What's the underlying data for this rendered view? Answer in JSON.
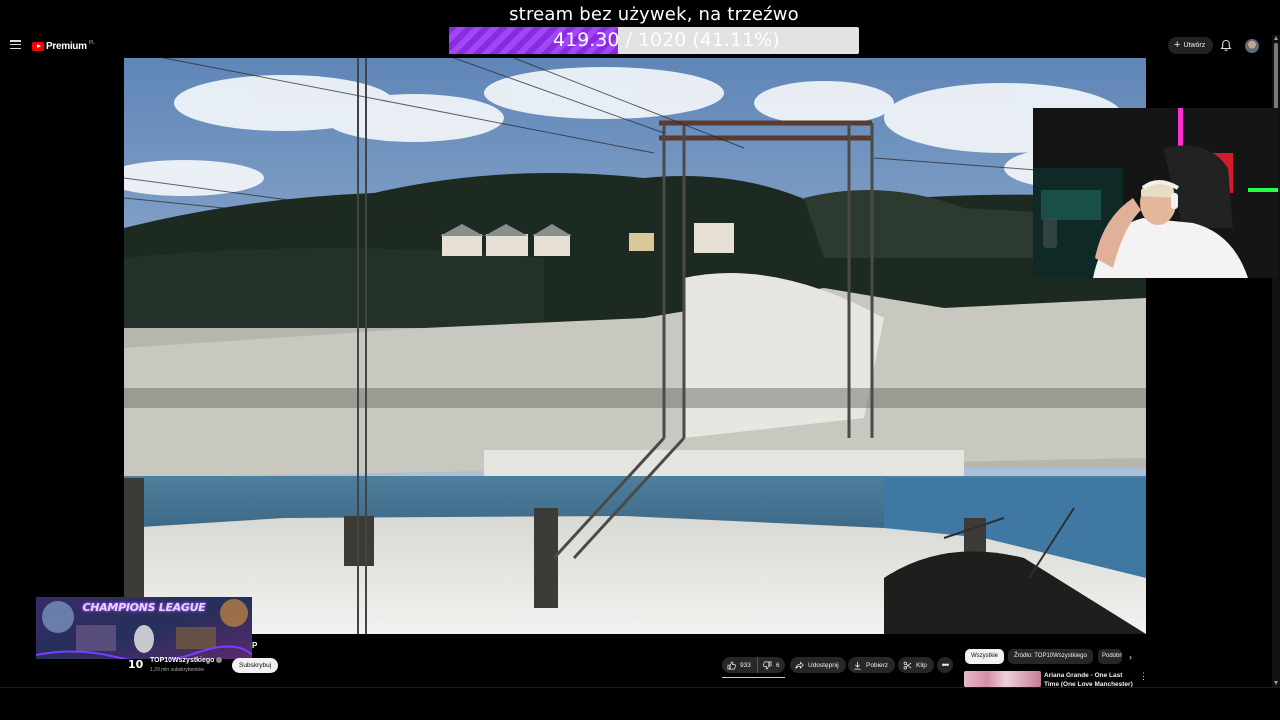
{
  "overlay": {
    "title": "stream bez używek, na trzeźwo",
    "progress": {
      "current": "419.30",
      "total": "/ 1020 (41.11%)",
      "fraction": 0.4111
    },
    "champions_text": "CHAMPIONS LEAGUE"
  },
  "header": {
    "logo_text": "Premium",
    "country": "PL",
    "create_label": "Utwórz"
  },
  "video": {
    "title_tail": "P"
  },
  "channel": {
    "logo": "10",
    "name": "TOP10Wszystkiego",
    "subscribers": "1,29 mln subskrybentów",
    "subscribe_label": "Subskrybuj"
  },
  "actions": {
    "likes": "933",
    "dislikes": "6",
    "share": "Udostępnij",
    "download": "Pobierz",
    "clip": "Klip",
    "more": "•••"
  },
  "chips": {
    "all": "Wszystkie",
    "source": "Źródło: TOP10Wszystkiego",
    "related": "Podobne"
  },
  "recommendation": {
    "title": "Ariana Grande - One Last Time (One Love Manchester)"
  },
  "colors": {
    "progress_fill": "#8a2be2",
    "youtube_red": "#ff0000",
    "background": "#000000"
  }
}
